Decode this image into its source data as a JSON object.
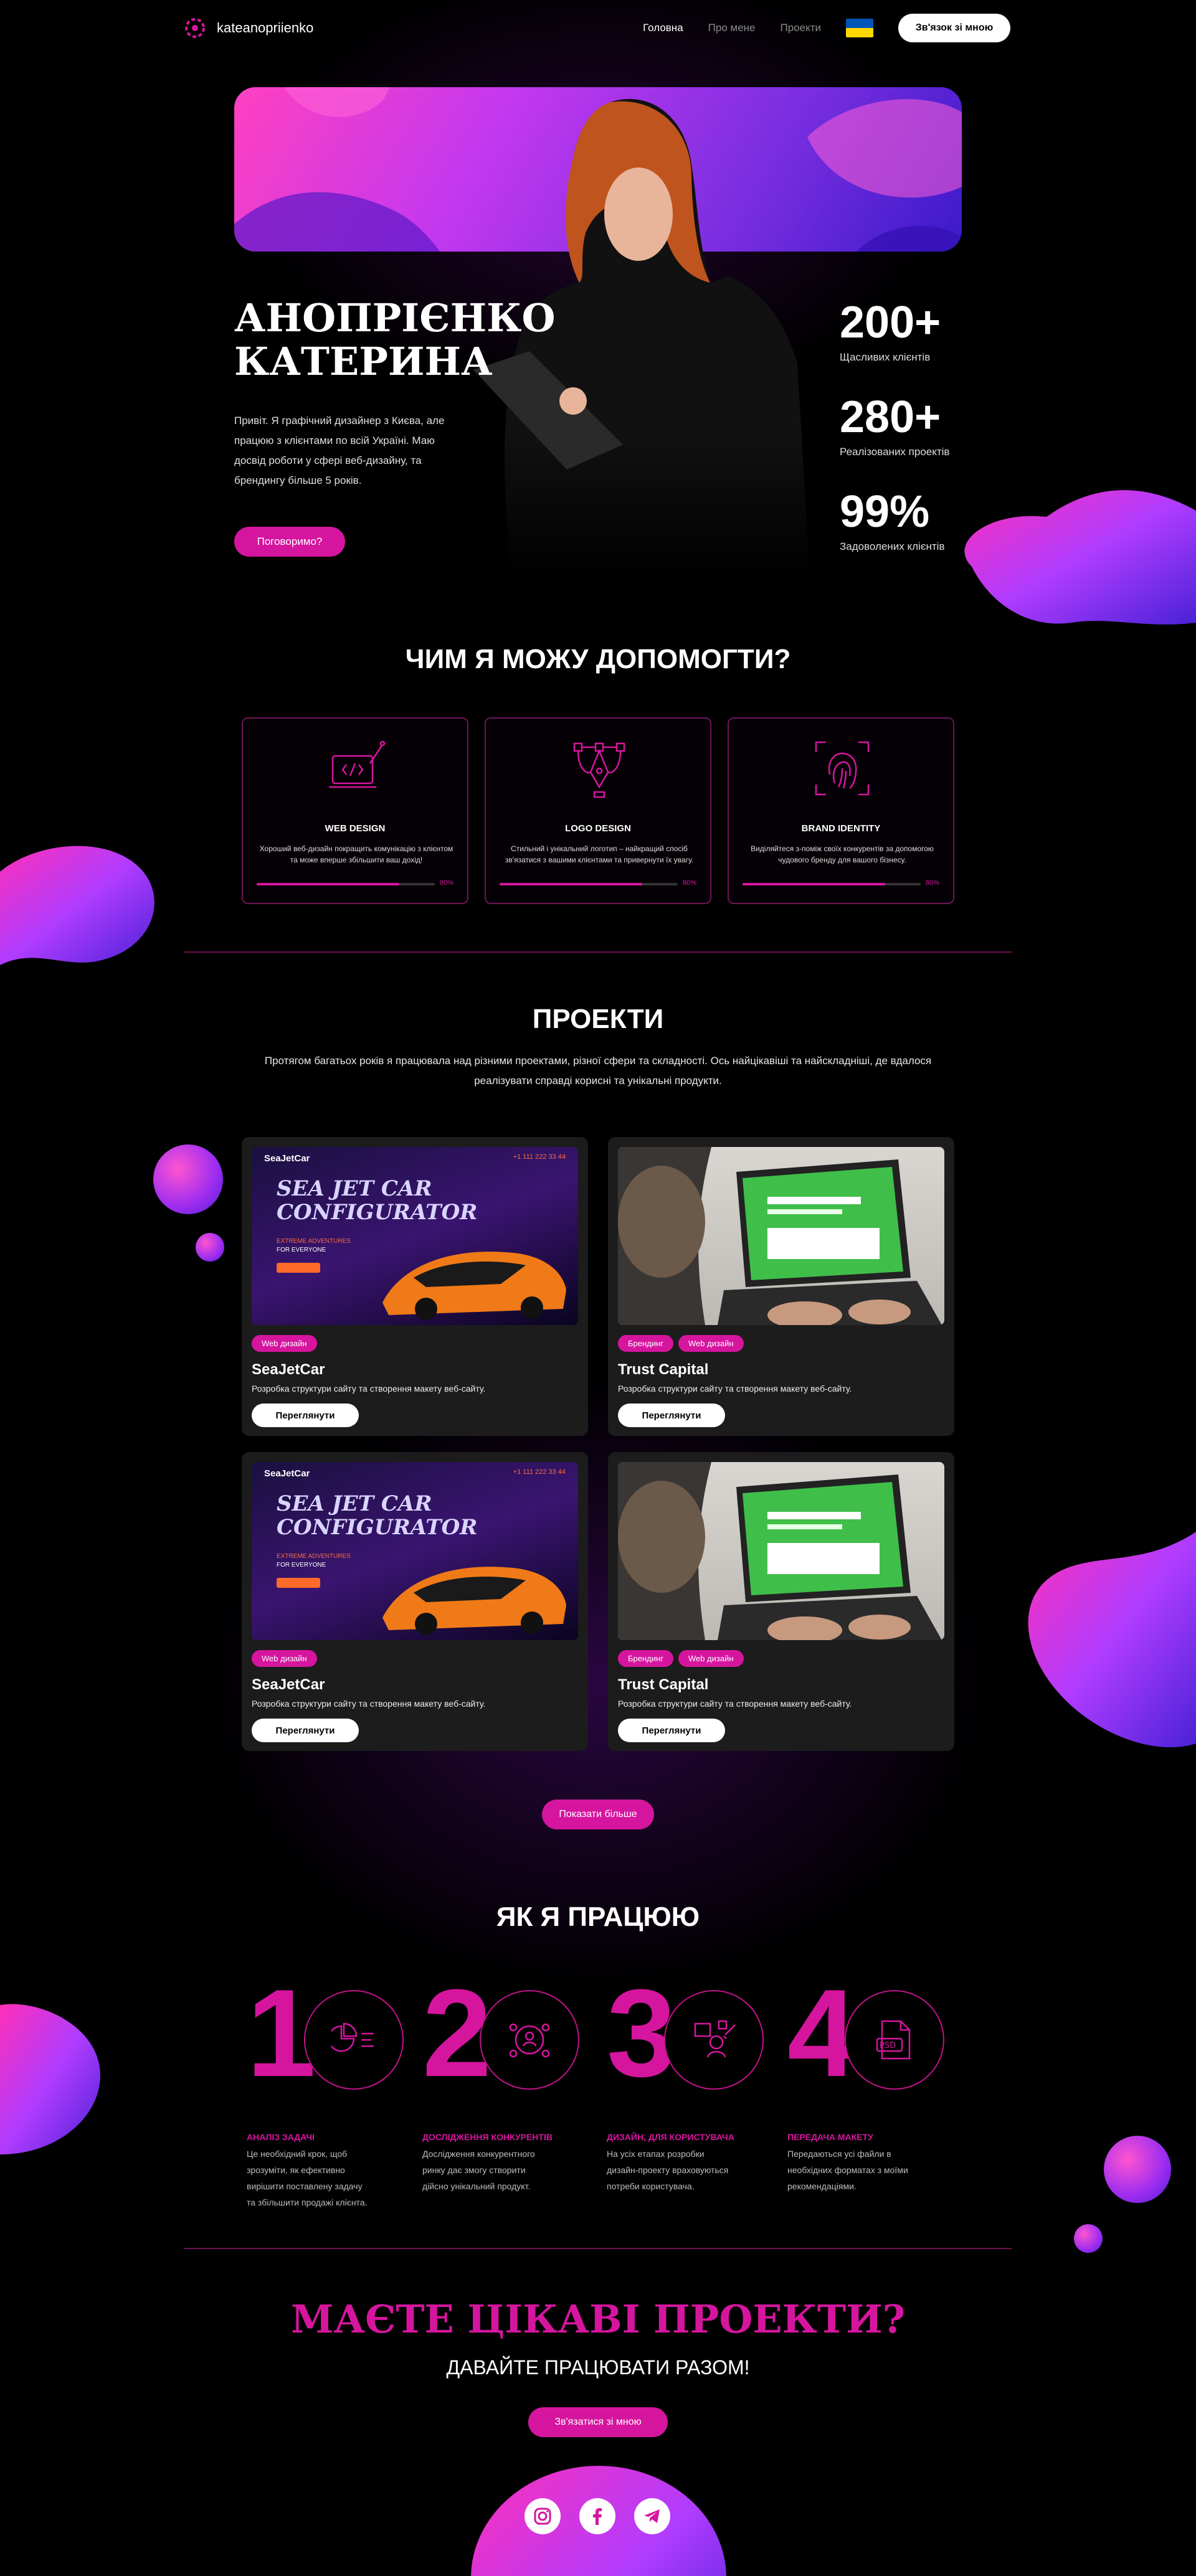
{
  "header": {
    "logo": "kateanopriienko",
    "nav": [
      "Головна",
      "Про мене",
      "Проекти"
    ],
    "contact_btn": "Зв'язок зі мною"
  },
  "hero": {
    "title_line1": "АНОПРІЄНКО",
    "title_line2": "КАТЕРИНА",
    "intro": "Привіт. Я графічний дизайнер з Києва, але працюю з клієнтами по всій Україні. Маю досвід роботи у сфері веб-дизайну, та брендингу більше 5 років.",
    "cta": "Поговоримо?",
    "stats": [
      {
        "value": "200+",
        "label": "Щасливих клієнтів"
      },
      {
        "value": "280+",
        "label": "Реалізованих проектів"
      },
      {
        "value": "99%",
        "label": "Задоволених клієнтів"
      }
    ]
  },
  "services": {
    "title": "ЧИМ Я МОЖУ ДОПОМОГТИ?",
    "items": [
      {
        "icon": "web-design-icon",
        "title": "WEB DESIGN",
        "desc": "Хороший веб-дизайн покращить комунікацію з клієнтом та може вперше збільшити ваш дохід!",
        "percent": "80%",
        "level": 0.8
      },
      {
        "icon": "logo-design-icon",
        "title": "LOGO DESIGN",
        "desc": "Стильний і унікальний логотип – найкращий спосіб зв'язатися з вашими клієнтами та привернути їх увагу.",
        "percent": "80%",
        "level": 0.8
      },
      {
        "icon": "fingerprint-icon",
        "title": "BRAND IDENTITY",
        "desc": "Виділяйтеся з-поміж своїх конкурентів за допомогою чудового бренду для вашого бізнесу.",
        "percent": "80%",
        "level": 0.8
      }
    ]
  },
  "projects": {
    "title": "ПРОЕКТИ",
    "intro": "Протягом багатьох років я працювала над різними проектами, різної сфери та складності. Ось найцікавіші та найскладніші, де вдалося реалізувати справді корисні та унікальні продукти.",
    "items": [
      {
        "kind": "seajet",
        "tags": [
          "Web дизайн"
        ],
        "title": "SeaJetCar",
        "desc": "Розробка структури сайту та створення макету веб-сайту.",
        "btn": "Переглянути",
        "shot_brand": "SeaJetCar",
        "shot_headline1": "SEA JET CAR",
        "shot_headline2": "CONFIGURATOR",
        "shot_sub1": "EXTREME ADVENTURES",
        "shot_sub2": "FOR EVERYONE",
        "shot_phone": "+1 111 222 33 44"
      },
      {
        "kind": "trust",
        "tags": [
          "Брендинг",
          "Web дизайн"
        ],
        "title": "Trust Capital",
        "desc": "Розробка структури сайту та створення макету веб-сайту.",
        "btn": "Переглянути"
      },
      {
        "kind": "seajet",
        "tags": [
          "Web дизайн"
        ],
        "title": "SeaJetCar",
        "desc": "Розробка структури сайту та створення макету веб-сайту.",
        "btn": "Переглянути",
        "shot_brand": "SeaJetCar",
        "shot_headline1": "SEA JET CAR",
        "shot_headline2": "CONFIGURATOR",
        "shot_sub1": "EXTREME ADVENTURES",
        "shot_sub2": "FOR EVERYONE",
        "shot_phone": "+1 111 222 33 44"
      },
      {
        "kind": "trust",
        "tags": [
          "Брендинг",
          "Web дизайн"
        ],
        "title": "Trust Capital",
        "desc": "Розробка структури сайту та створення макету веб-сайту.",
        "btn": "Переглянути"
      }
    ],
    "more_btn": "Показати більше"
  },
  "process": {
    "title": "ЯК Я ПРАЦЮЮ",
    "steps": [
      {
        "num": "1",
        "icon": "analysis-icon",
        "title": "АНАЛІЗ ЗАДАЧІ",
        "desc": "Це необхідний крок, щоб зрозуміти, як ефективно вирішити поставлену задачу та збільшити продажі клієнта."
      },
      {
        "num": "2",
        "icon": "competitor-research-icon",
        "title": "ДОСЛІДЖЕННЯ КОНКУРЕНТІВ",
        "desc": "Дослідження конкурентного ринку дає змогу створити дійсно унікальний продукт."
      },
      {
        "num": "3",
        "icon": "user-design-icon",
        "title": "ДИЗАЙН, ДЛЯ КОРИСТУВАЧА",
        "desc": "На усіх етапах розробки дизайн-проекту враховуються потреби користувача."
      },
      {
        "num": "4",
        "icon": "psd-file-icon",
        "title": "ПЕРЕДАЧА МАКЕТУ",
        "desc": "Передаються усі файли в необхідних форматах з моїми рекомендаціями."
      }
    ]
  },
  "cta": {
    "title": "МАЄТЕ ЦІКАВІ ПРОЕКТИ?",
    "subtitle": "ДАВАЙТЕ ПРАЦЮВАТИ РАЗОМ!",
    "btn": "Зв'язатися зі мною"
  },
  "socials": [
    "instagram-icon",
    "facebook-icon",
    "telegram-icon"
  ],
  "colors": {
    "accent": "#d6159f",
    "background": "#000000",
    "card": "#1c1c1c",
    "flag_blue": "#0057b7",
    "flag_yellow": "#ffd700"
  }
}
